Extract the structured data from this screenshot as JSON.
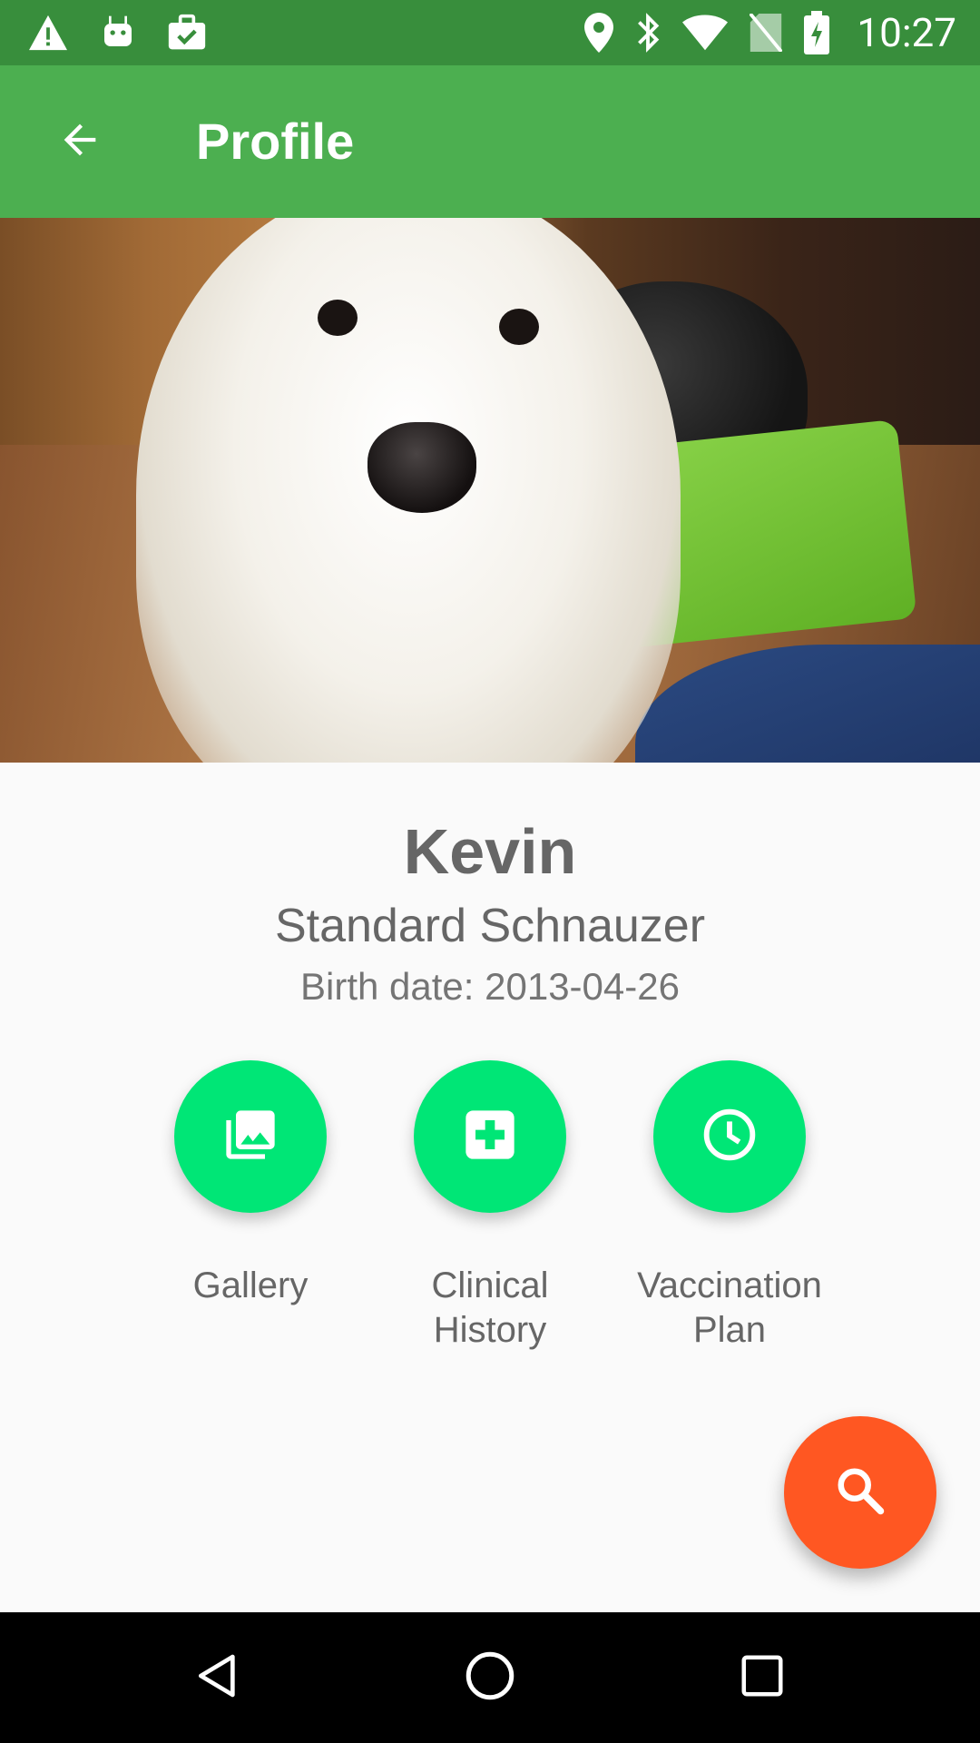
{
  "status_bar": {
    "time": "10:27",
    "left_icons": [
      "warning-icon",
      "android-icon",
      "briefcase-check-icon"
    ],
    "right_icons": [
      "location-icon",
      "bluetooth-icon",
      "wifi-icon",
      "no-sim-icon",
      "battery-charging-icon"
    ]
  },
  "app_bar": {
    "title": "Profile",
    "back_icon": "arrow-back-icon",
    "background": "#4caf50"
  },
  "profile": {
    "name": "Kevin",
    "breed": "Standard Schnauzer",
    "birth_date": "Birth date: 2013-04-26"
  },
  "actions": [
    {
      "label": "Gallery",
      "icon": "photo-library-icon"
    },
    {
      "label": "Clinical History",
      "icon": "medical-cross-icon"
    },
    {
      "label": "Vaccination Plan",
      "icon": "clock-icon"
    }
  ],
  "fab": {
    "icon": "search-icon",
    "color": "#ff5722"
  },
  "colors": {
    "status_bar": "#388e3c",
    "accent_green": "#00e676"
  },
  "nav_bar": {
    "icons": [
      "back-triangle-icon",
      "home-circle-icon",
      "recents-square-icon"
    ]
  }
}
